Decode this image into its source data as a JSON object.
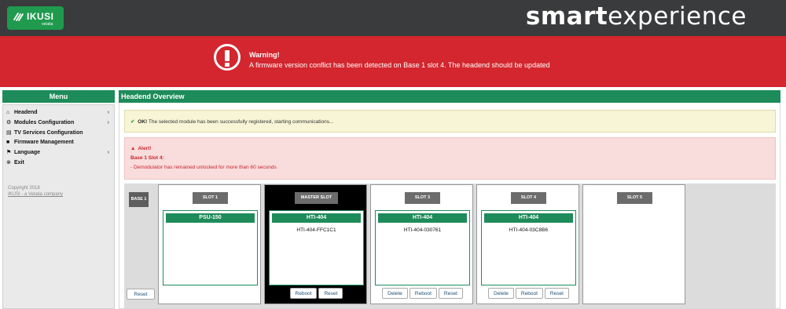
{
  "header": {
    "logo_text": "IKUSI",
    "logo_sub": "velatia",
    "brand_bold": "smart",
    "brand_light": "experience"
  },
  "warning": {
    "title": "Warning!",
    "message": "A firmware version conflict has been detected on Base 1 slot 4. The headend should be updated"
  },
  "menu": {
    "title": "Menu",
    "items": [
      {
        "icon": "home-icon",
        "glyph": "⌂",
        "label": "Headend",
        "has_submenu": true
      },
      {
        "icon": "gear-icon",
        "glyph": "⚙",
        "label": "Modules Configuration",
        "has_submenu": true
      },
      {
        "icon": "list-icon",
        "glyph": "▤",
        "label": "TV Services Configuration",
        "has_submenu": false
      },
      {
        "icon": "firmware-icon",
        "glyph": "■",
        "label": "Firmware Management",
        "has_submenu": false
      },
      {
        "icon": "flag-icon",
        "glyph": "⚑",
        "label": "Language",
        "has_submenu": true
      },
      {
        "icon": "exit-icon",
        "glyph": "⊗",
        "label": "Exit",
        "has_submenu": false
      }
    ],
    "copyright": "Copyright 2018",
    "company_link": "IKUSI - a Velatia company"
  },
  "main": {
    "title": "Headend Overview",
    "ok_label": "OK!",
    "ok_message": "The selected module has been successfully registered, starting communications...",
    "alert_title": "Alert!",
    "alert_location": "Base 1 Slot 4:",
    "alert_message": "- Demodulator has remained unlocked for more than 60 seconds"
  },
  "rack": {
    "base_label": "BASE 1",
    "reset_label": "Reset",
    "slots": [
      {
        "tag": "SLOT 1",
        "module": "PSU-150",
        "module_id": "",
        "buttons": []
      },
      {
        "tag": "MASTER SLOT",
        "module": "HTI-404",
        "module_id": "HTI-404-FFC1C1",
        "buttons": [
          "Reboot",
          "Reset"
        ]
      },
      {
        "tag": "SLOT 3",
        "module": "HTI-404",
        "module_id": "HTI-404-030761",
        "buttons": [
          "Delete",
          "Reboot",
          "Reset"
        ]
      },
      {
        "tag": "SLOT 4",
        "module": "HTI-404",
        "module_id": "HTI-404-03C8B6",
        "buttons": [
          "Delete",
          "Reboot",
          "Reset"
        ]
      },
      {
        "tag": "SLOT 5",
        "module": "",
        "module_id": "",
        "buttons": []
      }
    ]
  },
  "colors": {
    "green": "#1e8c5a",
    "warning_red": "#d3262e",
    "topbar": "#3a3b3c"
  }
}
